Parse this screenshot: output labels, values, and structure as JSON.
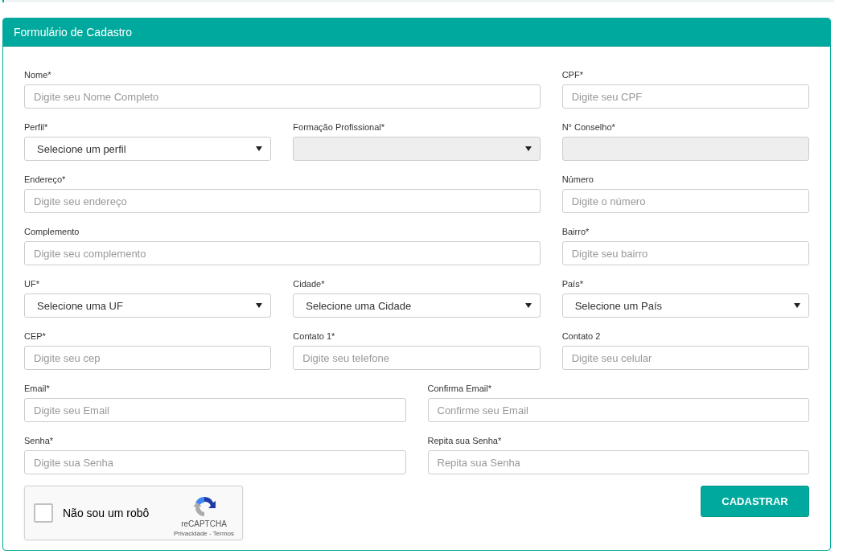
{
  "panel": {
    "title": "Formulário de Cadastro"
  },
  "rows": [
    {
      "kind": "wide-narrow",
      "fields": [
        {
          "label": "Nome*",
          "kind": "input",
          "placeholder": "Digite seu Nome Completo",
          "disabled": false
        },
        {
          "label": "CPF*",
          "kind": "input",
          "placeholder": "Digite seu CPF",
          "disabled": false
        }
      ]
    },
    {
      "kind": "thirds",
      "fields": [
        {
          "label": "Perfil*",
          "kind": "select",
          "value": "Selecione um perfil",
          "disabled": false
        },
        {
          "label": "Formação Profissional*",
          "kind": "select",
          "disabled": true
        },
        {
          "label": "N° Conselho*",
          "kind": "input",
          "disabled": true
        }
      ]
    },
    {
      "kind": "wide-narrow",
      "fields": [
        {
          "label": "Endereço*",
          "kind": "input",
          "placeholder": "Digite seu endereço",
          "disabled": false
        },
        {
          "label": "Número",
          "kind": "input",
          "placeholder": "Digite o número",
          "disabled": false
        }
      ]
    },
    {
      "kind": "wide-narrow",
      "fields": [
        {
          "label": "Complemento",
          "kind": "input",
          "placeholder": "Digite seu complemento",
          "disabled": false
        },
        {
          "label": "Bairro*",
          "kind": "input",
          "placeholder": "Digite seu bairro",
          "disabled": false
        }
      ]
    },
    {
      "kind": "thirds",
      "fields": [
        {
          "label": "UF*",
          "kind": "select",
          "value": "Selecione uma UF",
          "disabled": false
        },
        {
          "label": "Cidade*",
          "kind": "select",
          "value": "Selecione uma Cidade",
          "disabled": false
        },
        {
          "label": "País*",
          "kind": "select",
          "value": "Selecione um País",
          "disabled": false
        }
      ]
    },
    {
      "kind": "thirds",
      "fields": [
        {
          "label": "CEP*",
          "kind": "input",
          "placeholder": "Digite seu cep",
          "disabled": false
        },
        {
          "label": "Contato 1*",
          "kind": "input",
          "placeholder": "Digite seu telefone",
          "disabled": false
        },
        {
          "label": "Contato 2",
          "kind": "input",
          "placeholder": "Digite seu celular",
          "disabled": false
        }
      ]
    },
    {
      "kind": "halves",
      "fields": [
        {
          "label": "Email*",
          "kind": "input",
          "placeholder": "Digite seu Email",
          "disabled": false
        },
        {
          "label": "Confirma Email*",
          "kind": "input",
          "placeholder": "Confirme seu Email",
          "disabled": false
        }
      ]
    },
    {
      "kind": "halves",
      "fields": [
        {
          "label": "Senha*",
          "kind": "input",
          "placeholder": "Digite sua Senha",
          "disabled": false
        },
        {
          "label": "Repita sua Senha*",
          "kind": "input",
          "placeholder": "Repita sua Senha",
          "disabled": false
        }
      ]
    }
  ],
  "captcha": {
    "label": "Não sou um robô",
    "checked": false,
    "brand": "reCAPTCHA",
    "links": "Privacidade - Termos"
  },
  "submit_button": "CADASTRAR"
}
